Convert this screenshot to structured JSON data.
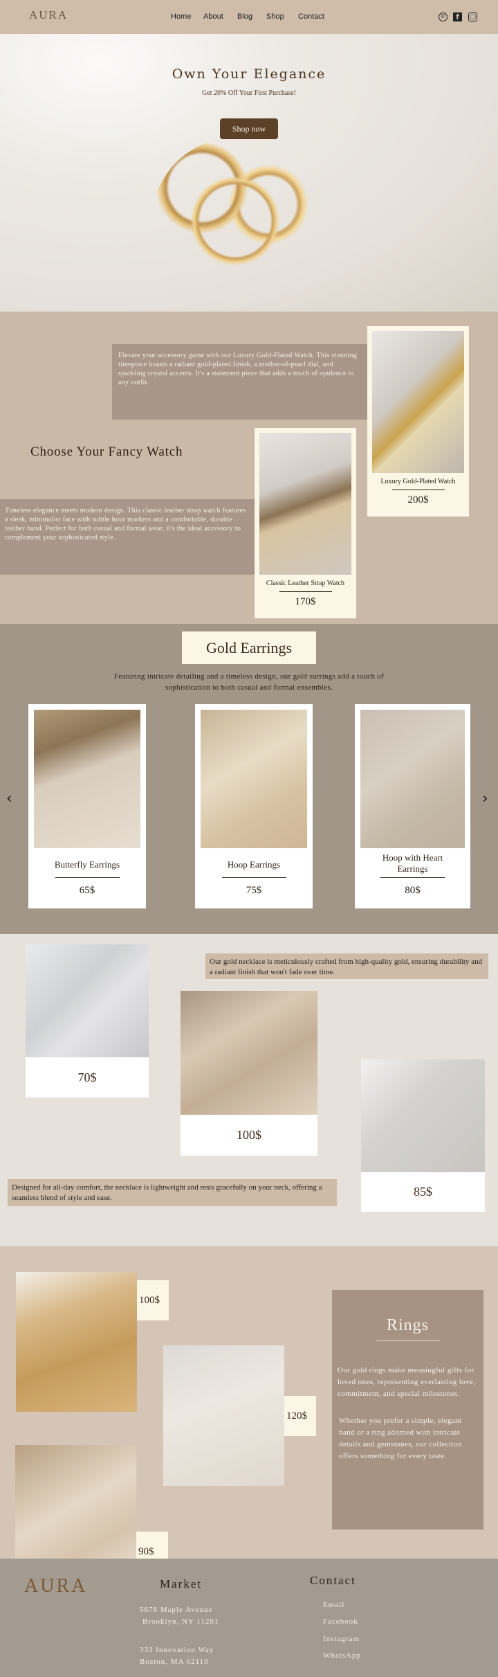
{
  "header": {
    "logo": "AURA",
    "nav": [
      "Home",
      "About",
      "Blog",
      "Shop",
      "Contact"
    ],
    "social_icons": [
      "whatsapp-icon",
      "facebook-icon",
      "instagram-icon"
    ]
  },
  "hero": {
    "title": "Own Your Elegance",
    "subtitle": "Get 20% Off Your First Purchase!",
    "button": "Shop now"
  },
  "watches": {
    "heading": "Choose Your Fancy Watch",
    "items": [
      {
        "name": "Luxury Gold-Plated Watch",
        "price": "200$",
        "description": "Elevate your accessory game with our Luxury Gold-Plated Watch. This stunning timepiece boasts a radiant gold-plated finish, a mother-of-pearl dial, and sparkling crystal accents. It's a statement piece that adds a touch of opulence to any outfit."
      },
      {
        "name": "Classic Leather Strap Watch",
        "price": "170$",
        "description": "Timeless elegance meets modern design. This classic leather strap watch features a sleek, minimalist face with subtle hour markers and a comfortable, durable leather band. Perfect for both casual and formal wear, it's the ideal accessory to complement your sophisticated style."
      }
    ]
  },
  "earrings": {
    "title": "Gold Earrings",
    "description": "Featuring intricate detailing and a timeless design, our gold earrings add a touch of sophistication to both casual and formal ensembles.",
    "items": [
      {
        "name": "Butterfly Earrings",
        "price": "65$"
      },
      {
        "name": "Hoop Earrings",
        "price": "75$"
      },
      {
        "name": "Hoop with Heart Earrings",
        "price": "80$"
      }
    ]
  },
  "necklaces": {
    "text_top": "Our gold necklace is meticulously crafted from high-quality gold, ensuring durability and a radiant finish that won't fade over time.",
    "text_bottom": "Designed for all-day comfort, the necklace is lightweight and rests gracefully on your neck, offering a seamless blend of style and ease.",
    "prices": [
      "70$",
      "100$",
      "85$"
    ]
  },
  "rings": {
    "title": "Rings",
    "prices": [
      "100$",
      "120$",
      "90$"
    ],
    "paragraph1": "Our gold rings make meaningful gifts for loved ones, representing everlasting love, commitment, and special milestones.",
    "paragraph2": "Whether you prefer a simple, elegant band or a ring adorned with intricate details and gemstones, our collection offers something for every taste."
  },
  "footer": {
    "logo": "AURA",
    "market_heading": "Market",
    "address1_line1": "5678 Maple Avenue",
    "address1_line2": "Brooklyn, NY 11201",
    "address2_line1": "333 Innovation Way",
    "address2_line2": "Boston, MA 02110",
    "contact_heading": "Contact",
    "links": [
      "Email",
      "Facebook",
      "Instagram",
      "WhatsApp"
    ]
  }
}
